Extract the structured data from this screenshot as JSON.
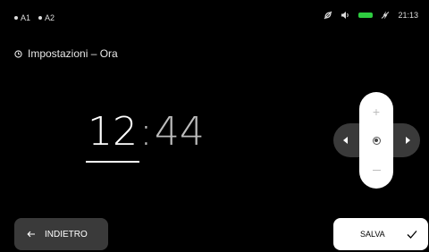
{
  "status_bar": {
    "indicators": [
      "A1",
      "A2"
    ],
    "icons": [
      "leaf-slash-icon",
      "speaker-icon",
      "battery-icon",
      "bolt-slash-icon"
    ],
    "battery_color": "#2ecc40",
    "time": "21:13"
  },
  "header": {
    "icon": "clock-icon",
    "title": "Impostazioni – Ora"
  },
  "clock_editor": {
    "hours": "12",
    "separator": ":",
    "minutes": "44",
    "selected_field": "hours"
  },
  "dpad": {
    "up_label": "+",
    "icons": [
      "arrow-left-icon",
      "arrow-right-icon",
      "plus-icon",
      "minus-icon",
      "center-dot-icon"
    ]
  },
  "footer": {
    "back_label": "INDIETRO",
    "save_label": "SALVA",
    "accent_color": "#ffffff"
  }
}
